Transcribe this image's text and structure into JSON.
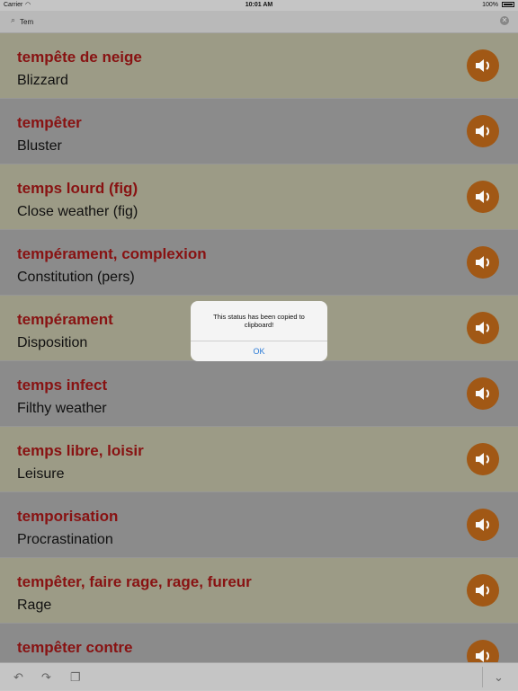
{
  "status_bar": {
    "carrier": "Carrier",
    "time": "10:01 AM",
    "battery": "100%"
  },
  "search": {
    "value": "Tem",
    "placeholder": ""
  },
  "entries": [
    {
      "term": "tempête de neige",
      "translation": "Blizzard"
    },
    {
      "term": "tempêter",
      "translation": "Bluster"
    },
    {
      "term": "temps lourd (fig)",
      "translation": "Close weather (fig)"
    },
    {
      "term": "tempérament, complexion",
      "translation": "Constitution (pers)"
    },
    {
      "term": "tempérament",
      "translation": "Disposition"
    },
    {
      "term": "temps infect",
      "translation": "Filthy weather"
    },
    {
      "term": "temps libre, loisir",
      "translation": "Leisure"
    },
    {
      "term": "temporisation",
      "translation": "Procrastination"
    },
    {
      "term": "tempêter, faire rage, rage, fureur",
      "translation": "Rage"
    },
    {
      "term": "tempêter contre",
      "translation": ""
    }
  ],
  "alert": {
    "message": "This status has been copied to clipboard!",
    "ok_label": "OK"
  },
  "colors": {
    "term_color": "#8b1313",
    "speaker_color": "#a55a16",
    "alt_row": "#a09f89",
    "normal_row": "#8e8e8e",
    "ok_color": "#2a7ad7"
  },
  "icons": {
    "speaker": "speaker-icon",
    "undo": "undo-icon",
    "redo": "redo-icon",
    "paste": "clipboard-icon",
    "dismiss": "chevron-down-icon"
  }
}
